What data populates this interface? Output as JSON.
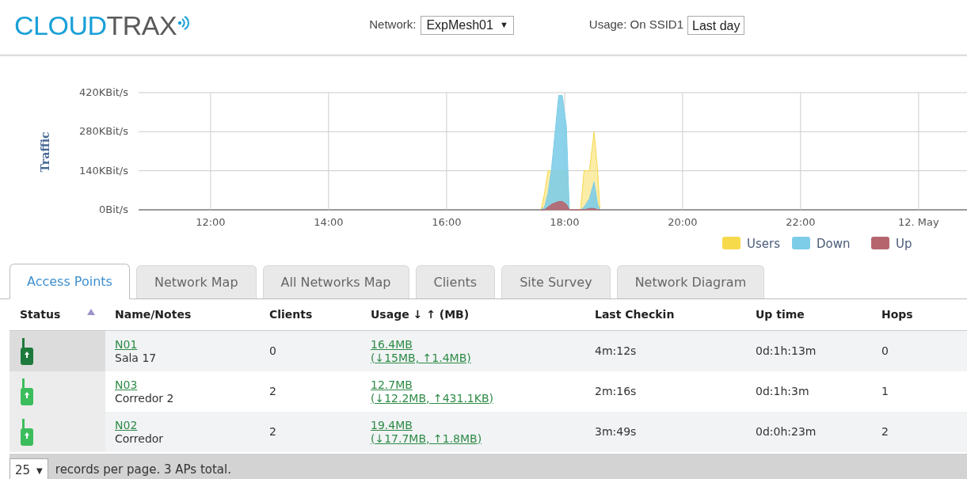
{
  "header": {
    "logo": {
      "part_1": "CLOUD",
      "part_2": "TRAX"
    },
    "network_label": "Network:",
    "network_value": "ExpMesh01",
    "network_caret": "▼",
    "usage_label": "Usage: On SSID1",
    "usage_value": "Last day"
  },
  "traffic_chart": {
    "chart_data": {
      "type": "area",
      "ylabel": "Traffic",
      "grid": true,
      "legend": true,
      "xlim": [
        10.78,
        24.82
      ],
      "ylim": [
        0,
        420
      ],
      "x": [
        17.6,
        17.66,
        17.72,
        17.78,
        17.9,
        17.96,
        18.03,
        18.08,
        18.2,
        18.27,
        18.33,
        18.42,
        18.5,
        18.56,
        18.6
      ],
      "series": [
        {
          "name": "Users",
          "color": "#f7d94c",
          "values": [
            0,
            60,
            140,
            140,
            140,
            140,
            140,
            0,
            0,
            0,
            140,
            140,
            280,
            140,
            0
          ]
        },
        {
          "name": "Down",
          "color": "#7ecde8",
          "values": [
            0,
            10,
            60,
            150,
            410,
            410,
            300,
            0,
            0,
            0,
            10,
            40,
            100,
            20,
            0
          ]
        },
        {
          "name": "Up",
          "color": "#b5646e",
          "values": [
            0,
            0,
            10,
            20,
            30,
            30,
            20,
            0,
            0,
            0,
            0,
            5,
            5,
            0,
            0
          ]
        }
      ],
      "xticks": [
        {
          "value": 12,
          "label": "12:00"
        },
        {
          "value": 14,
          "label": "14:00"
        },
        {
          "value": 16,
          "label": "16:00"
        },
        {
          "value": 18,
          "label": "18:00"
        },
        {
          "value": 20,
          "label": "20:00"
        },
        {
          "value": 22,
          "label": "22:00"
        },
        {
          "value": 24,
          "label": "12. May"
        }
      ],
      "yticks": [
        {
          "value": 0,
          "label": "0Bit/s"
        },
        {
          "value": 140,
          "label": "140KBit/s"
        },
        {
          "value": 280,
          "label": "280KBit/s"
        },
        {
          "value": 420,
          "label": "420KBit/s"
        }
      ]
    }
  },
  "tabs": [
    {
      "label": "Access Points",
      "selected": true
    },
    {
      "label": "Network Map",
      "selected": false
    },
    {
      "label": "All Networks Map",
      "selected": false
    },
    {
      "label": "Clients",
      "selected": false
    },
    {
      "label": "Site Survey",
      "selected": false
    },
    {
      "label": "Network Diagram",
      "selected": false
    }
  ],
  "table": {
    "columns": [
      "Status",
      "Name/Notes",
      "Clients",
      "Usage ↓ ↑ (MB)",
      "Last Checkin",
      "Up time",
      "Hops"
    ],
    "rows": [
      {
        "selected": true,
        "name": "N01",
        "notes": "Sala 17",
        "clients": "0",
        "usage": "16.4MB",
        "usage_detail": "(↓15MB, ↑1.4MB)",
        "last_checkin": "4m:12s",
        "up_time": "0d:1h:13m",
        "hops": "0"
      },
      {
        "selected": false,
        "name": "N03",
        "notes": "Corredor 2",
        "clients": "2",
        "usage": "12.7MB",
        "usage_detail": "(↓12.2MB, ↑431.1KB)",
        "last_checkin": "2m:16s",
        "up_time": "0d:1h:3m",
        "hops": "1"
      },
      {
        "selected": false,
        "name": "N02",
        "notes": "Corredor",
        "clients": "2",
        "usage": "19.4MB",
        "usage_detail": "(↓17.7MB, ↑1.8MB)",
        "last_checkin": "3m:49s",
        "up_time": "0d:0h:23m",
        "hops": "2"
      }
    ]
  },
  "footer": {
    "per_page": "25",
    "caret": "▼",
    "text": "records per page. 3 APs total."
  }
}
